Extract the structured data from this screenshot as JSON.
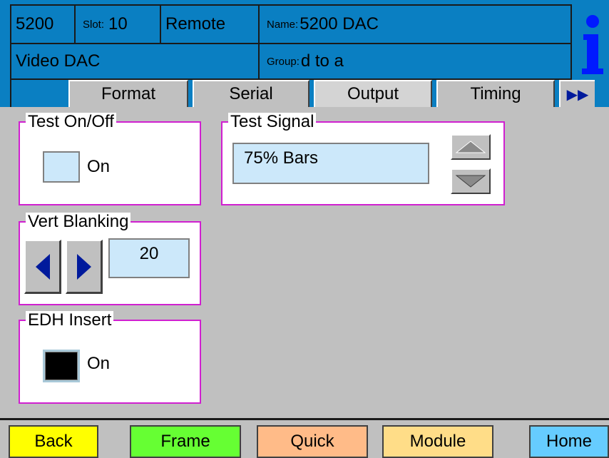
{
  "header": {
    "model": "5200",
    "slot_label": "Slot:",
    "slot_value": "10",
    "mode": "Remote",
    "name_label": "Name:",
    "name_value": "5200 DAC",
    "device_type": "Video DAC",
    "group_label": "Group:",
    "group_value": "d to a",
    "info_icon": "info-icon",
    "colors": {
      "header_bg": "#0a7fc2",
      "info": "#001aff"
    }
  },
  "tabs": [
    {
      "label": "Format",
      "active": false
    },
    {
      "label": "Serial",
      "active": false
    },
    {
      "label": "Output",
      "active": true
    },
    {
      "label": "Timing",
      "active": false
    }
  ],
  "tab_more_icon": "double-right-arrow-icon",
  "tab_more_glyph": "▶▶",
  "test_onoff": {
    "title": "Test On/Off",
    "checkbox_label": "On",
    "checked": false
  },
  "test_signal": {
    "title": "Test Signal",
    "value": "75% Bars"
  },
  "vert_blanking": {
    "title": "Vert Blanking",
    "value": "20"
  },
  "edh_insert": {
    "title": "EDH Insert",
    "checkbox_label": "On",
    "checked": true
  },
  "bottom_buttons": [
    {
      "label": "Back",
      "color": "#ffff00"
    },
    {
      "label": "Frame",
      "color": "#66ff33"
    },
    {
      "label": "Quick",
      "color": "#ffbb88"
    },
    {
      "label": "Module",
      "color": "#ffdd88"
    },
    {
      "label": "Home",
      "color": "#66ccff"
    }
  ],
  "colors": {
    "group_border": "#d020d0",
    "field_bg": "#cce8fa",
    "panel_bg": "#c0c0c0"
  }
}
